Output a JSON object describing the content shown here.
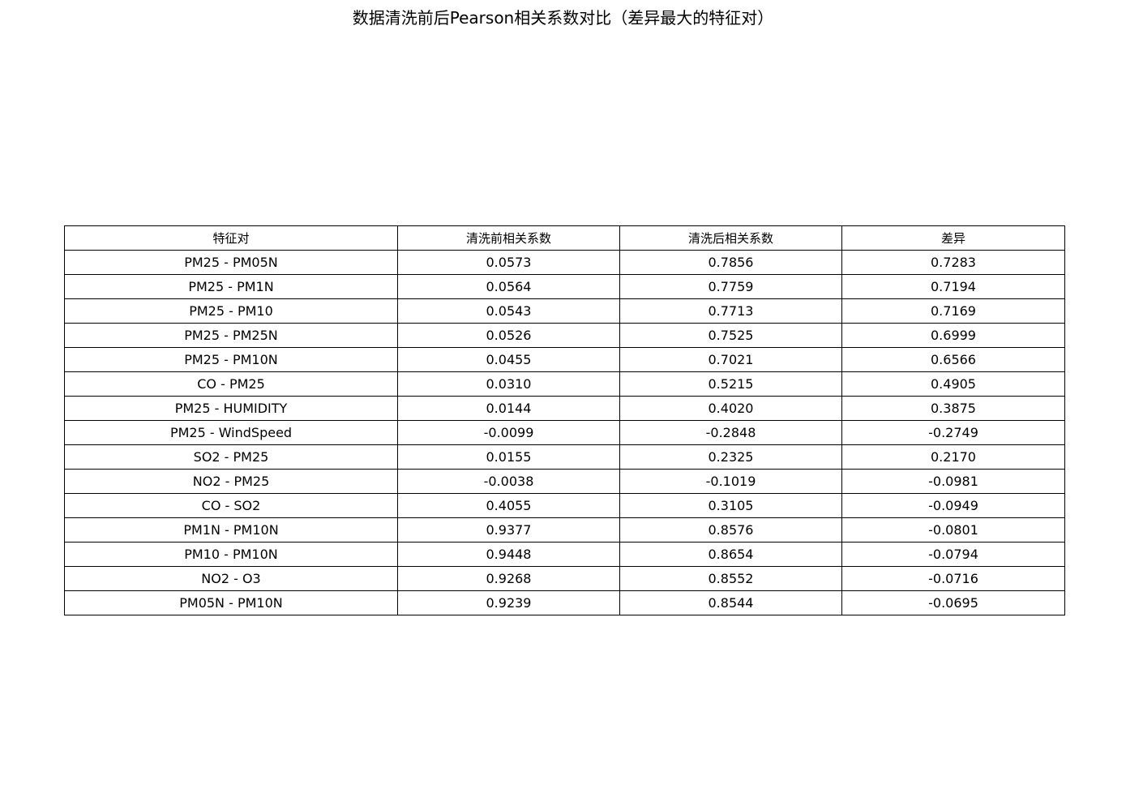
{
  "chart_data": {
    "type": "table",
    "title": "数据清洗前后Pearson相关系数对比（差异最大的特征对）",
    "columns": [
      "特征对",
      "清洗前相关系数",
      "清洗后相关系数",
      "差异"
    ],
    "rows": [
      [
        "PM25 - PM05N",
        "0.0573",
        "0.7856",
        "0.7283"
      ],
      [
        "PM25 - PM1N",
        "0.0564",
        "0.7759",
        "0.7194"
      ],
      [
        "PM25 - PM10",
        "0.0543",
        "0.7713",
        "0.7169"
      ],
      [
        "PM25 - PM25N",
        "0.0526",
        "0.7525",
        "0.6999"
      ],
      [
        "PM25 - PM10N",
        "0.0455",
        "0.7021",
        "0.6566"
      ],
      [
        "CO - PM25",
        "0.0310",
        "0.5215",
        "0.4905"
      ],
      [
        "PM25 - HUMIDITY",
        "0.0144",
        "0.4020",
        "0.3875"
      ],
      [
        "PM25 - WindSpeed",
        "-0.0099",
        "-0.2848",
        "-0.2749"
      ],
      [
        "SO2 - PM25",
        "0.0155",
        "0.2325",
        "0.2170"
      ],
      [
        "NO2 - PM25",
        "-0.0038",
        "-0.1019",
        "-0.0981"
      ],
      [
        "CO - SO2",
        "0.4055",
        "0.3105",
        "-0.0949"
      ],
      [
        "PM1N - PM10N",
        "0.9377",
        "0.8576",
        "-0.0801"
      ],
      [
        "PM10 - PM10N",
        "0.9448",
        "0.8654",
        "-0.0794"
      ],
      [
        "NO2 - O3",
        "0.9268",
        "0.8552",
        "-0.0716"
      ],
      [
        "PM05N - PM10N",
        "0.9239",
        "0.8544",
        "-0.0695"
      ]
    ]
  }
}
